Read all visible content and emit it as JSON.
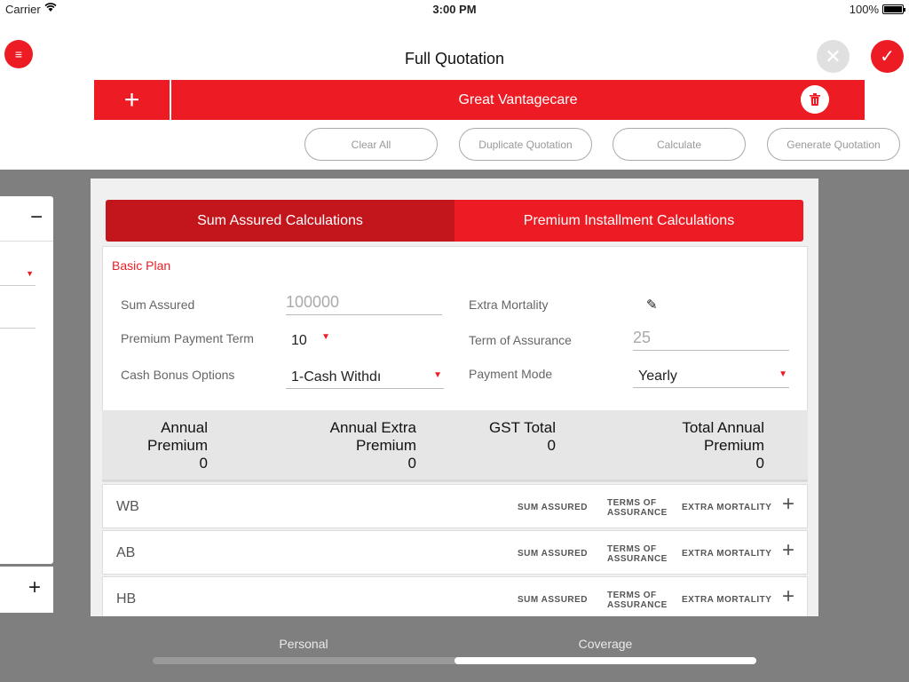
{
  "status_bar": {
    "carrier": "Carrier",
    "time": "3:00 PM",
    "battery": "100%"
  },
  "header": {
    "title": "Full Quotation",
    "menu_icon": "≡",
    "close_icon": "✕",
    "confirm_icon": "✓",
    "add_icon": "+",
    "plan_tab": "Great Vantagecare",
    "trash_icon": "🗑",
    "actions": [
      "Clear All",
      "Duplicate Quotation",
      "Calculate",
      "Generate Quotation"
    ]
  },
  "left_panel": {
    "minus": "−",
    "plus": "+",
    "caret": "▼"
  },
  "segments": [
    "Sum Assured Calculations",
    "Premium Installment Calculations"
  ],
  "basic_plan": {
    "title": "Basic Plan",
    "sum_assured_label": "Sum Assured",
    "sum_assured_value": "100000",
    "ppt_label": "Premium Payment Term",
    "ppt_value": "10",
    "cash_bonus_label": "Cash Bonus Options",
    "cash_bonus_value": "1-Cash Withdı",
    "extra_mortality_label": "Extra Mortality",
    "term_label": "Term of Assurance",
    "term_value": "25",
    "payment_mode_label": "Payment Mode",
    "payment_mode_value": "Yearly",
    "arrow": "▼",
    "pencil": "✎"
  },
  "totals": [
    {
      "label1": "Annual",
      "label2": "Premium",
      "value": "0"
    },
    {
      "label1": "Annual Extra",
      "label2": "Premium",
      "value": "0"
    },
    {
      "label1": "GST Total",
      "label2": "0",
      "value": ""
    },
    {
      "label1": "Total Annual",
      "label2": "Premium",
      "value": "0"
    }
  ],
  "riders": [
    {
      "name": "WB"
    },
    {
      "name": "AB"
    },
    {
      "name": "HB"
    }
  ],
  "rider_columns": {
    "sum_assured": "SUM ASSURED",
    "terms1": "TERMS OF",
    "terms2": "ASSURANCE",
    "extra_mortality": "EXTRA MORTALITY",
    "add": "+"
  },
  "steps": [
    "Personal",
    "Coverage"
  ],
  "colors": {
    "accent": "#ed1c24",
    "accent_dark": "#c2151c"
  }
}
